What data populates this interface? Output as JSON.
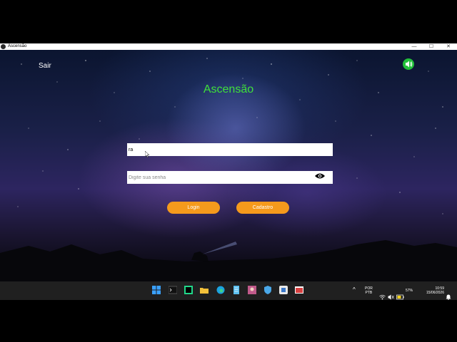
{
  "window": {
    "title": "Ascensão",
    "controls": {
      "minimize": "—",
      "maximize": "☐",
      "close": "✕"
    }
  },
  "app": {
    "exit_label": "Sair",
    "sound_icon": "speaker-icon",
    "title": "Ascensão",
    "username": {
      "value": "ra",
      "placeholder": ""
    },
    "password": {
      "value": "",
      "placeholder": "Digite sua senha"
    },
    "show_password_icon": "eye-icon",
    "login_label": "Login",
    "register_label": "Cadastro"
  },
  "taskbar": {
    "language_line1": "POR",
    "language_line2": "PTB",
    "battery": "57%",
    "time": "10:59",
    "date": "15/06/2026",
    "tray_chevron": "^"
  },
  "colors": {
    "title_green": "#3fe03a",
    "button_orange": "#f59a1c",
    "sound_green": "#22c03a",
    "taskbar": "#202020"
  }
}
